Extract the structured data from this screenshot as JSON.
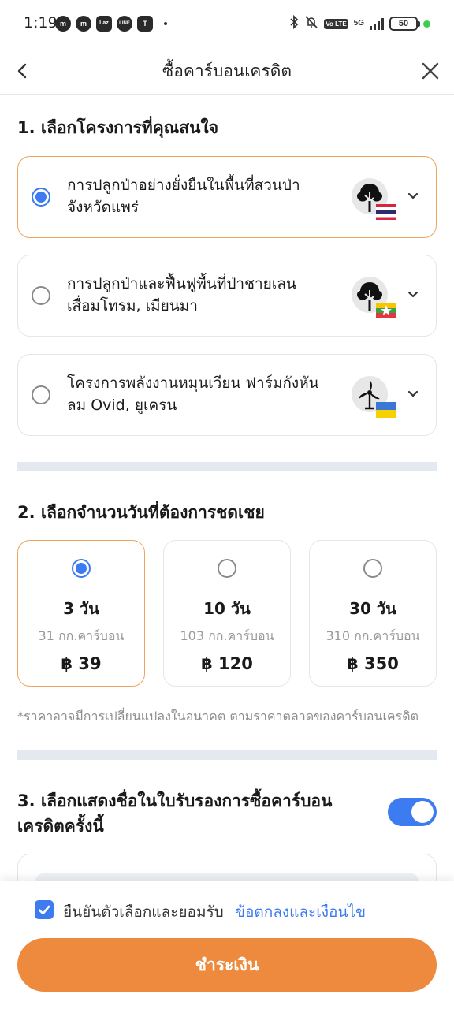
{
  "status_bar": {
    "time": "1:19",
    "apps": [
      "messenger-icon",
      "messenger-icon",
      "lazada-icon",
      "line-icon",
      "teams-icon"
    ],
    "app_labels": [
      "m",
      "m",
      "Laz",
      "LINE",
      "T"
    ],
    "network": "5G",
    "volte": "Vo LTE",
    "battery": "50"
  },
  "header": {
    "title": "ซื้อคาร์บอนเครดิต"
  },
  "section1": {
    "title": "1. เลือกโครงการที่คุณสนใจ",
    "projects": [
      {
        "name": "การปลูกป่าอย่างยั่งยืนในพื้นที่สวนป่าจังหวัดแพร่",
        "icon": "tree-icon",
        "flag": "thailand-flag",
        "selected": true
      },
      {
        "name": "การปลูกป่าและฟื้นฟูพื้นที่ป่าชายเลนเสื่อมโทรม, เมียนมา",
        "icon": "tree-icon",
        "flag": "myanmar-flag",
        "selected": false
      },
      {
        "name": "โครงการพลังงานหมุนเวียน ฟาร์มกังหันลม Ovid, ยูเครน",
        "icon": "wind-turbine-icon",
        "flag": "ukraine-flag",
        "selected": false
      }
    ]
  },
  "section2": {
    "title": "2. เลือกจำนวนวันที่ต้องการชดเชย",
    "options": [
      {
        "days": "3 วัน",
        "carbon": "31 กก.คาร์บอน",
        "price": "฿ 39",
        "selected": true
      },
      {
        "days": "10 วัน",
        "carbon": "103 กก.คาร์บอน",
        "price": "฿ 120",
        "selected": false
      },
      {
        "days": "30 วัน",
        "carbon": "310 กก.คาร์บอน",
        "price": "฿ 350",
        "selected": false
      }
    ],
    "note": "*ราคาอาจมีการเปลี่ยนแปลงในอนาคต ตามราคาตลาดของคาร์บอนเครดิต"
  },
  "section3": {
    "title": "3. เลือกแสดงชื่อในใบรับรองการซื้อคาร์บอนเครดิตครั้งนี้",
    "toggle_on": true
  },
  "footer": {
    "agree_text": "ยืนยันตัวเลือกและยอมรับ",
    "terms_link": "ข้อตกลงและเงื่อนไข",
    "checked": true,
    "pay_label": "ชำระเงิน"
  },
  "colors": {
    "accent_blue": "#3d7bf0",
    "accent_orange": "#ee8a3e",
    "selected_border": "#f0a55c"
  }
}
